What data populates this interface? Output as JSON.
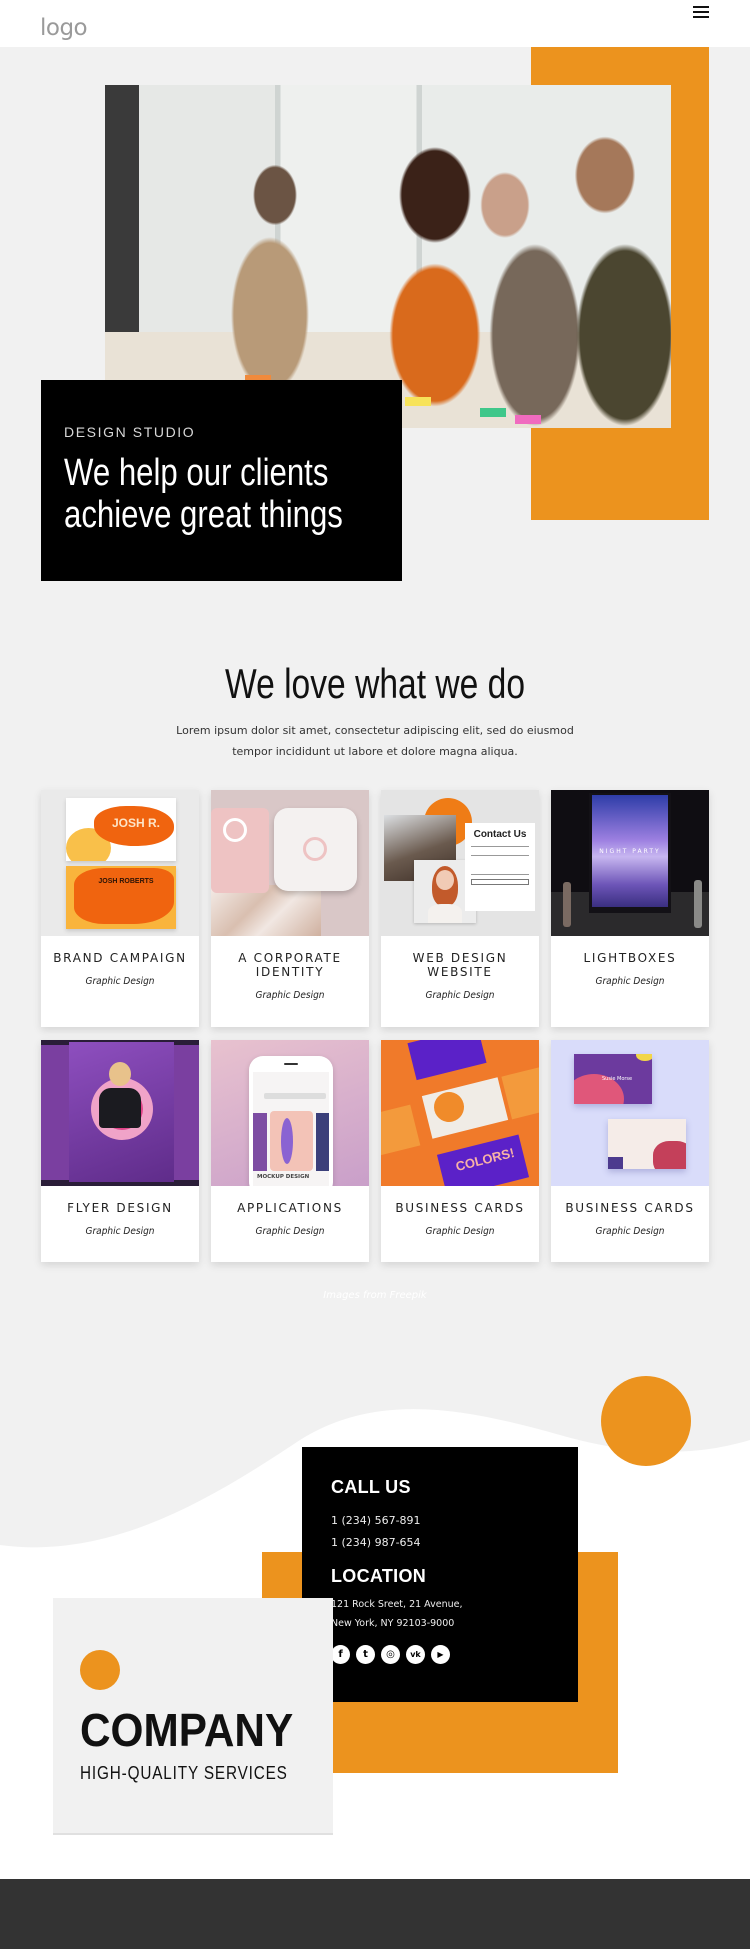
{
  "header": {
    "logo": "logo",
    "menu_icon": "hamburger-menu-icon"
  },
  "hero": {
    "image_alt": "Team of colleagues collaborating around a table with sticky notes",
    "eyebrow": "DESIGN STUDIO",
    "title_line1": "We help our clients",
    "title_line2": "achieve great things"
  },
  "services": {
    "title": "We love what we do",
    "text_line1": "Lorem ipsum dolor sit amet, consectetur adipiscing elit, sed do eiusmod",
    "text_line2": "tempor incididunt ut labore et dolore magna aliqua.",
    "cards": [
      {
        "title_line1": "BRAND CAMPAIGN",
        "title_line2": "",
        "subtitle": "Graphic Design",
        "thumb": "business-cards-orange"
      },
      {
        "title_line1": "A CORPORATE",
        "title_line2": "IDENTITY",
        "subtitle": "Graphic Design",
        "thumb": "pink-identity-cards"
      },
      {
        "title_line1": "WEB DESIGN",
        "title_line2": "WEBSITE",
        "subtitle": "Graphic Design",
        "thumb": "contact-us-mockup"
      },
      {
        "title_line1": "LIGHTBOXES",
        "title_line2": "",
        "subtitle": "Graphic Design",
        "thumb": "night-party-lightbox"
      },
      {
        "title_line1": "FLYER DESIGN",
        "title_line2": "",
        "subtitle": "Graphic Design",
        "thumb": "purple-flyer"
      },
      {
        "title_line1": "APPLICATIONS",
        "title_line2": "",
        "subtitle": "Graphic Design",
        "thumb": "phone-mockup"
      },
      {
        "title_line1": "BUSINESS CARDS",
        "title_line2": "",
        "subtitle": "Graphic Design",
        "thumb": "colors-branding-cards"
      },
      {
        "title_line1": "BUSINESS CARDS",
        "title_line2": "",
        "subtitle": "Graphic Design",
        "thumb": "susie-morse-cards"
      }
    ],
    "thumb_texts": {
      "card1_front": "JOSH R.",
      "card1_back": "JOSH ROBERTS",
      "card3_form": "Contact Us",
      "card4_poster": "NIGHT PARTY",
      "card6_app": "MOCKUP DESIGN",
      "card7_brand": "COLORS!",
      "card8_name": "Susie Morse"
    },
    "credit": "Images from Freepik"
  },
  "contact": {
    "call_title": "CALL US",
    "phone1": "1 (234) 567-891",
    "phone2": "1 (234) 987-654",
    "location_title": "LOCATION",
    "address1": "121 Rock Sreet, 21 Avenue,",
    "address2": "New York, NY 92103-9000",
    "socials": [
      {
        "name": "facebook",
        "glyph": "f"
      },
      {
        "name": "twitter",
        "glyph": "t"
      },
      {
        "name": "instagram",
        "glyph": "◎"
      },
      {
        "name": "vk",
        "glyph": "vk"
      },
      {
        "name": "youtube",
        "glyph": "▶"
      }
    ]
  },
  "company": {
    "name": "COMPANY",
    "tagline": "HIGH-QUALITY SERVICES"
  },
  "colors": {
    "accent": "#ec931e",
    "background": "#f1f1f1",
    "dark": "#000000",
    "footer": "#333333"
  }
}
